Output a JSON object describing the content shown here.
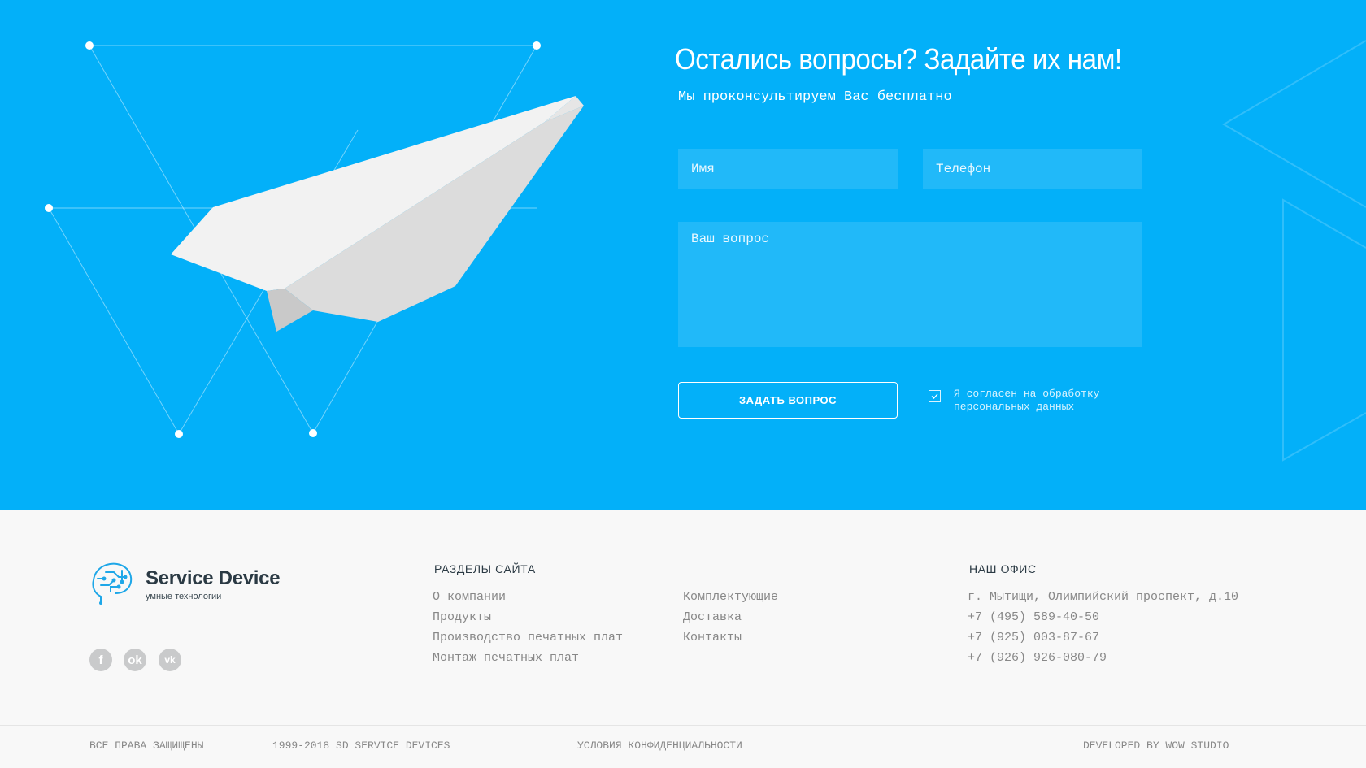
{
  "form": {
    "title": "Остались вопросы? Задайте их нам!",
    "subtitle": "Мы проконсультируем Вас бесплатно",
    "name_placeholder": "Имя",
    "phone_placeholder": "Телефон",
    "question_placeholder": "Ваш вопрос",
    "submit_label": "ЗАДАТЬ ВОПРОС",
    "consent_label": "Я согласен на обработку персональных данных",
    "consent_checked": true
  },
  "footer": {
    "brand_name": "Service Device",
    "brand_tagline": "умные технологии",
    "social": [
      {
        "icon": "facebook-icon",
        "glyph": "f"
      },
      {
        "icon": "odnoklassniki-icon",
        "glyph": "ok"
      },
      {
        "icon": "vk-icon",
        "glyph": "vk"
      }
    ],
    "sections_title": "РАЗДЕЛЫ САЙТА",
    "sections_col1": [
      "О компании",
      "Продукты",
      "Производство печатных плат",
      "Монтаж печатных плат"
    ],
    "sections_col2": [
      "Комплектующие",
      "Доставка",
      "Контакты"
    ],
    "office_title": "НАШ ОФИС",
    "office": [
      "г. Мытищи, Олимпийский проспект, д.10",
      "+7 (495) 589-40-50",
      "+7 (925) 003-87-67",
      "+7 (926) 926-080-79"
    ]
  },
  "bottom_bar": {
    "rights": "ВСЕ ПРАВА ЗАЩИЩЕНЫ",
    "years": "1999-2018 SD SERVICE DEVICES",
    "privacy": "УСЛОВИЯ КОНФИДЕНЦИАЛЬНОСТИ",
    "developer": "DEVELOPED BY WOW STUDIO"
  },
  "colors": {
    "hero_bg": "#03b0f9",
    "footer_bg": "#f8f8f8",
    "heading": "#2b3a44",
    "muted": "#888888",
    "social_bg": "#c9cacb"
  }
}
